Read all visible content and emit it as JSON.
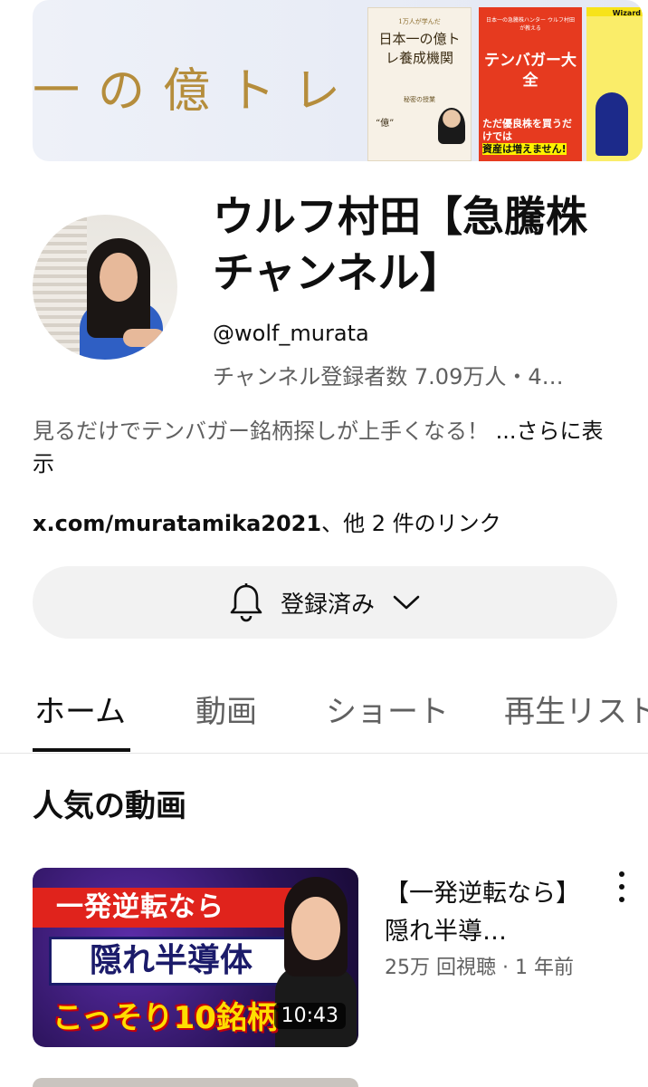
{
  "banner": {
    "title": "一の億トレ",
    "books": [
      {
        "kicker": "1万人が学んだ",
        "title": "日本一の億トレ養成機関",
        "subtitle": "秘密の授業",
        "tag": "“億”"
      },
      {
        "top": "日本一の急騰株ハンター ウルフ村田が教える",
        "title": "テンバガー大全",
        "bottom_pre": "ただ優良株を買うだけでは",
        "bottom_hl": "資産は増えません!"
      },
      {
        "label": "Wizard"
      }
    ]
  },
  "channel": {
    "name": "ウルフ村田【急騰株チャンネル】",
    "handle": "@wolf_murata",
    "stats": "チャンネル登録者数 7.09万人・4…",
    "description": "見るだけでテンバガー銘柄探しが上手くなる！",
    "more_label": "...さらに表示",
    "link_url": "x.com/muratamika2021",
    "link_more": "、他 2 件のリンク"
  },
  "subscribe": {
    "label": "登録済み",
    "icon": "bell-icon",
    "chevron": "chevron-down-icon"
  },
  "tabs": [
    {
      "label": "ホーム",
      "active": true
    },
    {
      "label": "動画",
      "active": false
    },
    {
      "label": "ショート",
      "active": false
    },
    {
      "label": "再生リスト",
      "active": false
    }
  ],
  "section": {
    "title": "人気の動画"
  },
  "videos": [
    {
      "title": "【一発逆転なら】隠れ半導…",
      "meta": "25万 回視聴 · 1 年前",
      "duration": "10:43",
      "thumb_line1": "一発逆転なら",
      "thumb_line2": "隠れ半導体",
      "thumb_line3": "こっそり10銘柄"
    }
  ],
  "colors": {
    "text_primary": "#0f0f0f",
    "text_secondary": "#606060",
    "button_bg": "#f2f2f2",
    "banner_gold": "#b58d3c",
    "book_red": "#e63a1f"
  }
}
